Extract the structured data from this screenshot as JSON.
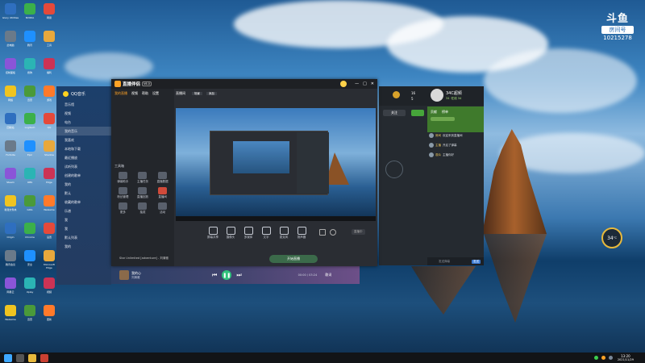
{
  "watermark": {
    "brand": "斗鱼",
    "room_label": "房间号",
    "room_id": "10215278"
  },
  "desktop_icons": [
    {
      "label": "Glary Utilities"
    },
    {
      "label": "NVIDIA"
    },
    {
      "label": "网易"
    },
    {
      "label": "此电脑"
    },
    {
      "label": "腾讯"
    },
    {
      "label": "工具"
    },
    {
      "label": "控制面板"
    },
    {
      "label": "搜狗"
    },
    {
      "label": "福利"
    },
    {
      "label": "网络"
    },
    {
      "label": "迅雷"
    },
    {
      "label": "游戏"
    },
    {
      "label": "回收站"
    },
    {
      "label": "Logitech"
    },
    {
      "label": "QQ"
    },
    {
      "label": "Fortnite"
    },
    {
      "label": "Epic"
    },
    {
      "label": "Shadow"
    },
    {
      "label": "Steam"
    },
    {
      "label": "OBS"
    },
    {
      "label": "Edge"
    },
    {
      "label": "新建文件夹"
    },
    {
      "label": "GOG"
    },
    {
      "label": "WeGame"
    },
    {
      "label": "Origin"
    },
    {
      "label": "Chrome"
    },
    {
      "label": "设置"
    },
    {
      "label": "腾讯会议"
    },
    {
      "label": "安全"
    },
    {
      "label": "Microsoft Edge"
    },
    {
      "label": "网易云"
    },
    {
      "label": "Uplay"
    },
    {
      "label": "视频"
    },
    {
      "label": "WeGame"
    },
    {
      "label": "迅雷"
    },
    {
      "label": "更新"
    }
  ],
  "music_sidebar": {
    "title": "QQ音乐",
    "items": [
      "音乐馆",
      "视频",
      "电台",
      "我的音乐",
      "我喜欢",
      "本地和下载",
      "最近播放",
      "试听列表",
      "创建的歌单",
      "我的",
      "默认",
      "收藏的歌单",
      "乐谱",
      "我",
      "我",
      "默认列表",
      "我的"
    ]
  },
  "streamer": {
    "logo": "直播伴侣",
    "badge": "V6.0",
    "tabs": [
      "我的直播",
      "视频",
      "帮助",
      "设置"
    ],
    "scene_tab": "直播间",
    "scene_buttons": [
      "场景",
      "添加"
    ],
    "tools_title": "工具箱",
    "tools": [
      "弹幕助手",
      "主播任务",
      "直播数据",
      "粉丝管理",
      "直播回放",
      "直播间",
      "更多",
      "抽奖",
      "活动"
    ],
    "controls": [
      "屏幕共享",
      "摄像头",
      "多媒体",
      "文字",
      "麦克风",
      "扬声器"
    ],
    "start_button": "开始直播",
    "bottom_note": "Star Unlimited [adventure] - 刘清雅",
    "status": "直播中"
  },
  "player": {
    "track": "我的心",
    "artist": "刘清雅",
    "time": "00:00 / 03:24",
    "mode": "歌词"
  },
  "room_panel": {
    "name": "34C超频",
    "sub": "34 ·在线 34",
    "counts": [
      "16",
      "5"
    ],
    "follow_btn": "关注",
    "tabs": [
      "贡献",
      "榜单"
    ],
    "messages": [
      {
        "user": "房间",
        "text": "欢迎来到直播间"
      },
      {
        "user": "主播",
        "text": "开启了弹幕"
      },
      {
        "user": "观众",
        "text": "主播你好"
      }
    ],
    "input_placeholder": "发送弹幕",
    "send_label": "发送"
  },
  "temp_widget": {
    "value": "34",
    "unit": "°C"
  },
  "taskbar": {
    "time": "13:20",
    "date": "2021/11/29"
  }
}
